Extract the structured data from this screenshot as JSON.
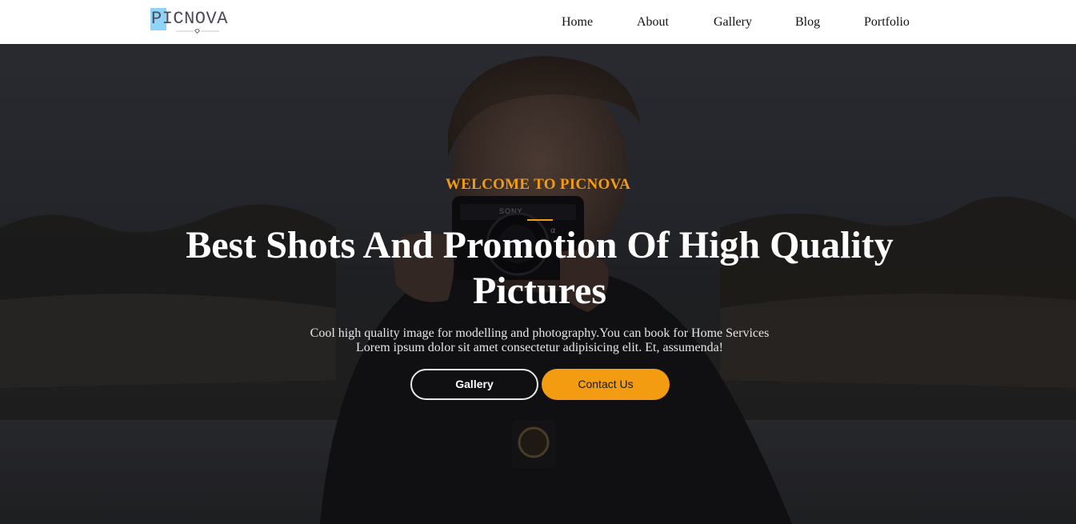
{
  "brand": {
    "logo_text": "PICNOVA",
    "accent_color": "#8fd3f7"
  },
  "nav": {
    "items": [
      {
        "label": "Home"
      },
      {
        "label": "About"
      },
      {
        "label": "Gallery"
      },
      {
        "label": "Blog"
      },
      {
        "label": "Portfolio"
      }
    ]
  },
  "hero": {
    "eyebrow": "WELCOME TO PICNOVA",
    "headline_line1": "Best Shots And Promotion Of High Quality",
    "headline_line2": "Pictures",
    "lead_line1": "Cool high quality image for modelling and photography.You can book for Home Services",
    "lead_line2": "Lorem ipsum dolor sit amet consectetur adipisicing elit. Et, assumenda!",
    "gallery_button": "Gallery",
    "contact_button": "Contact Us",
    "camera_brand": "SONY",
    "background_image": "man-holding-camera-photo",
    "accent_color": "#f39c12"
  }
}
